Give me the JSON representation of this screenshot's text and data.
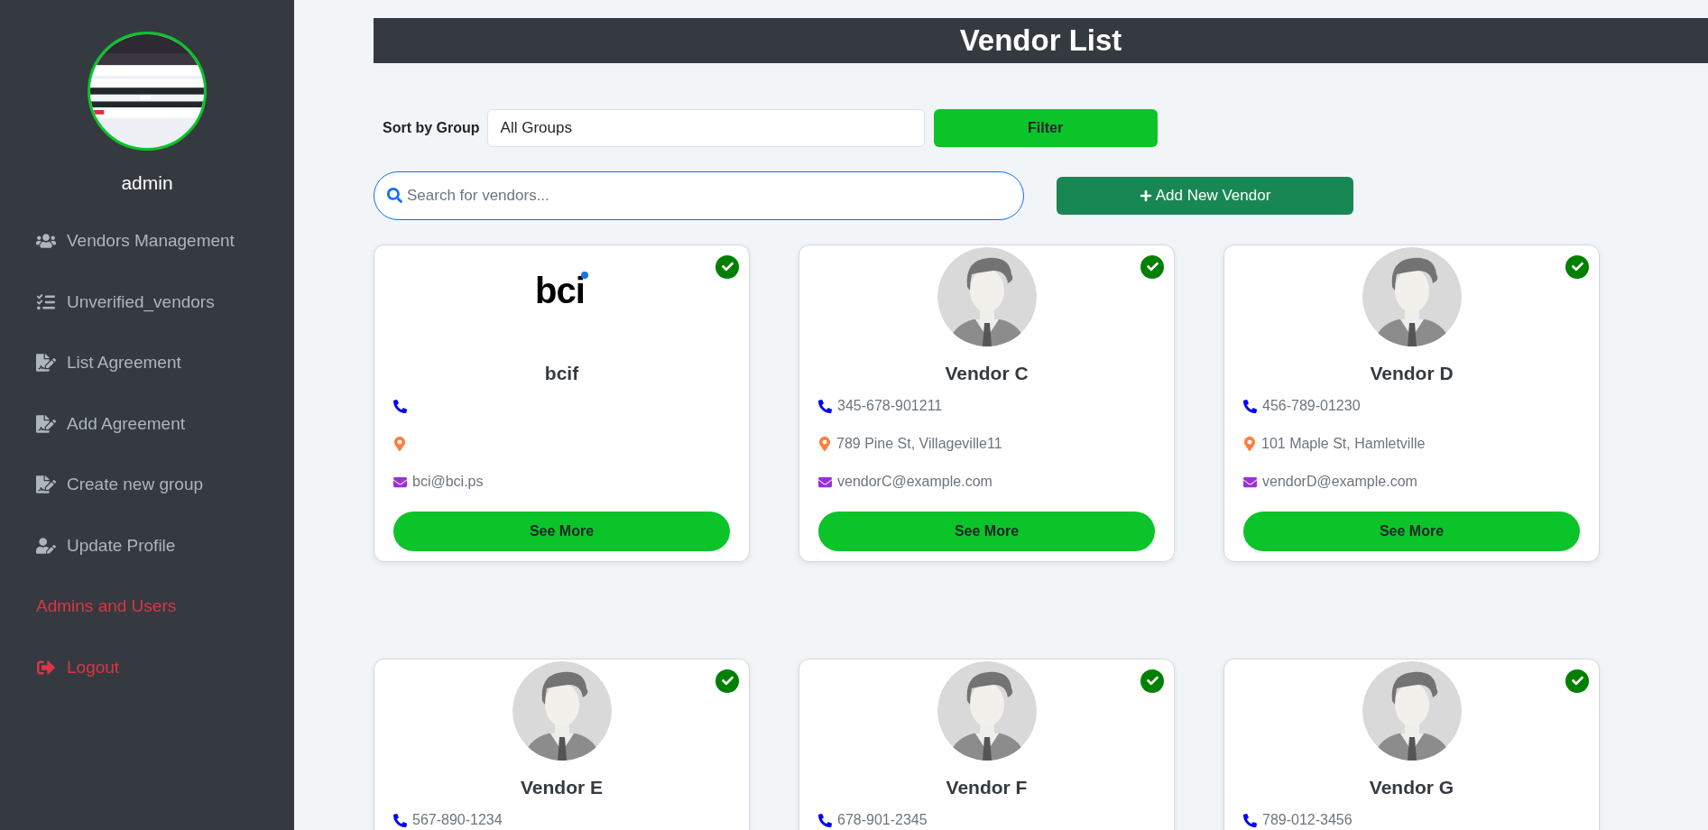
{
  "sidebar": {
    "profile": {
      "name": "admin"
    },
    "items": [
      {
        "label": "Vendors Management",
        "kind": "nav"
      },
      {
        "label": "Unverified_vendors",
        "kind": "nav"
      },
      {
        "label": "List Agreement",
        "kind": "nav"
      },
      {
        "label": "Add Agreement",
        "kind": "nav"
      },
      {
        "label": "Create new group",
        "kind": "nav"
      },
      {
        "label": "Update Profile",
        "kind": "nav"
      },
      {
        "label": "Admins and Users",
        "kind": "danger"
      },
      {
        "label": "Logout",
        "kind": "danger"
      }
    ]
  },
  "header": {
    "title": "Vendor List"
  },
  "filter": {
    "label": "Sort by Group",
    "value": "All Groups",
    "button": "Filter"
  },
  "search": {
    "placeholder": "Search for vendors..."
  },
  "add_button": "Add New Vendor",
  "vendors": [
    {
      "image": {
        "kind": "logo",
        "text": "bci"
      },
      "verified": true,
      "name": "bcif",
      "fields": [
        {
          "kind": "phone"
        },
        {
          "kind": "address"
        },
        {
          "kind": "email",
          "text": "bci@bci.ps"
        }
      ],
      "button": "See More"
    },
    {
      "image": {
        "kind": "avatar"
      },
      "verified": true,
      "name": "Vendor C",
      "fields": [
        {
          "kind": "phone",
          "text": "345-678-901211"
        },
        {
          "kind": "address",
          "text": "789 Pine St, Villageville11"
        },
        {
          "kind": "email",
          "text": "vendorC@example.com"
        }
      ],
      "button": "See More"
    },
    {
      "image": {
        "kind": "avatar"
      },
      "verified": true,
      "name": "Vendor D",
      "fields": [
        {
          "kind": "phone",
          "text": "456-789-01230"
        },
        {
          "kind": "address",
          "text": "101 Maple St, Hamletville"
        },
        {
          "kind": "email",
          "text": "vendorD@example.com"
        }
      ],
      "button": "See More"
    },
    {
      "image": {
        "kind": "avatar"
      },
      "verified": true,
      "name": "Vendor E",
      "fields": [
        {
          "kind": "phone",
          "text": "567-890-1234"
        }
      ]
    },
    {
      "image": {
        "kind": "avatar"
      },
      "verified": true,
      "name": "Vendor F",
      "fields": [
        {
          "kind": "phone",
          "text": "678-901-2345"
        }
      ]
    },
    {
      "image": {
        "kind": "avatar"
      },
      "verified": true,
      "name": "Vendor G",
      "fields": [
        {
          "kind": "phone",
          "text": "789-012-3456"
        }
      ]
    }
  ]
}
